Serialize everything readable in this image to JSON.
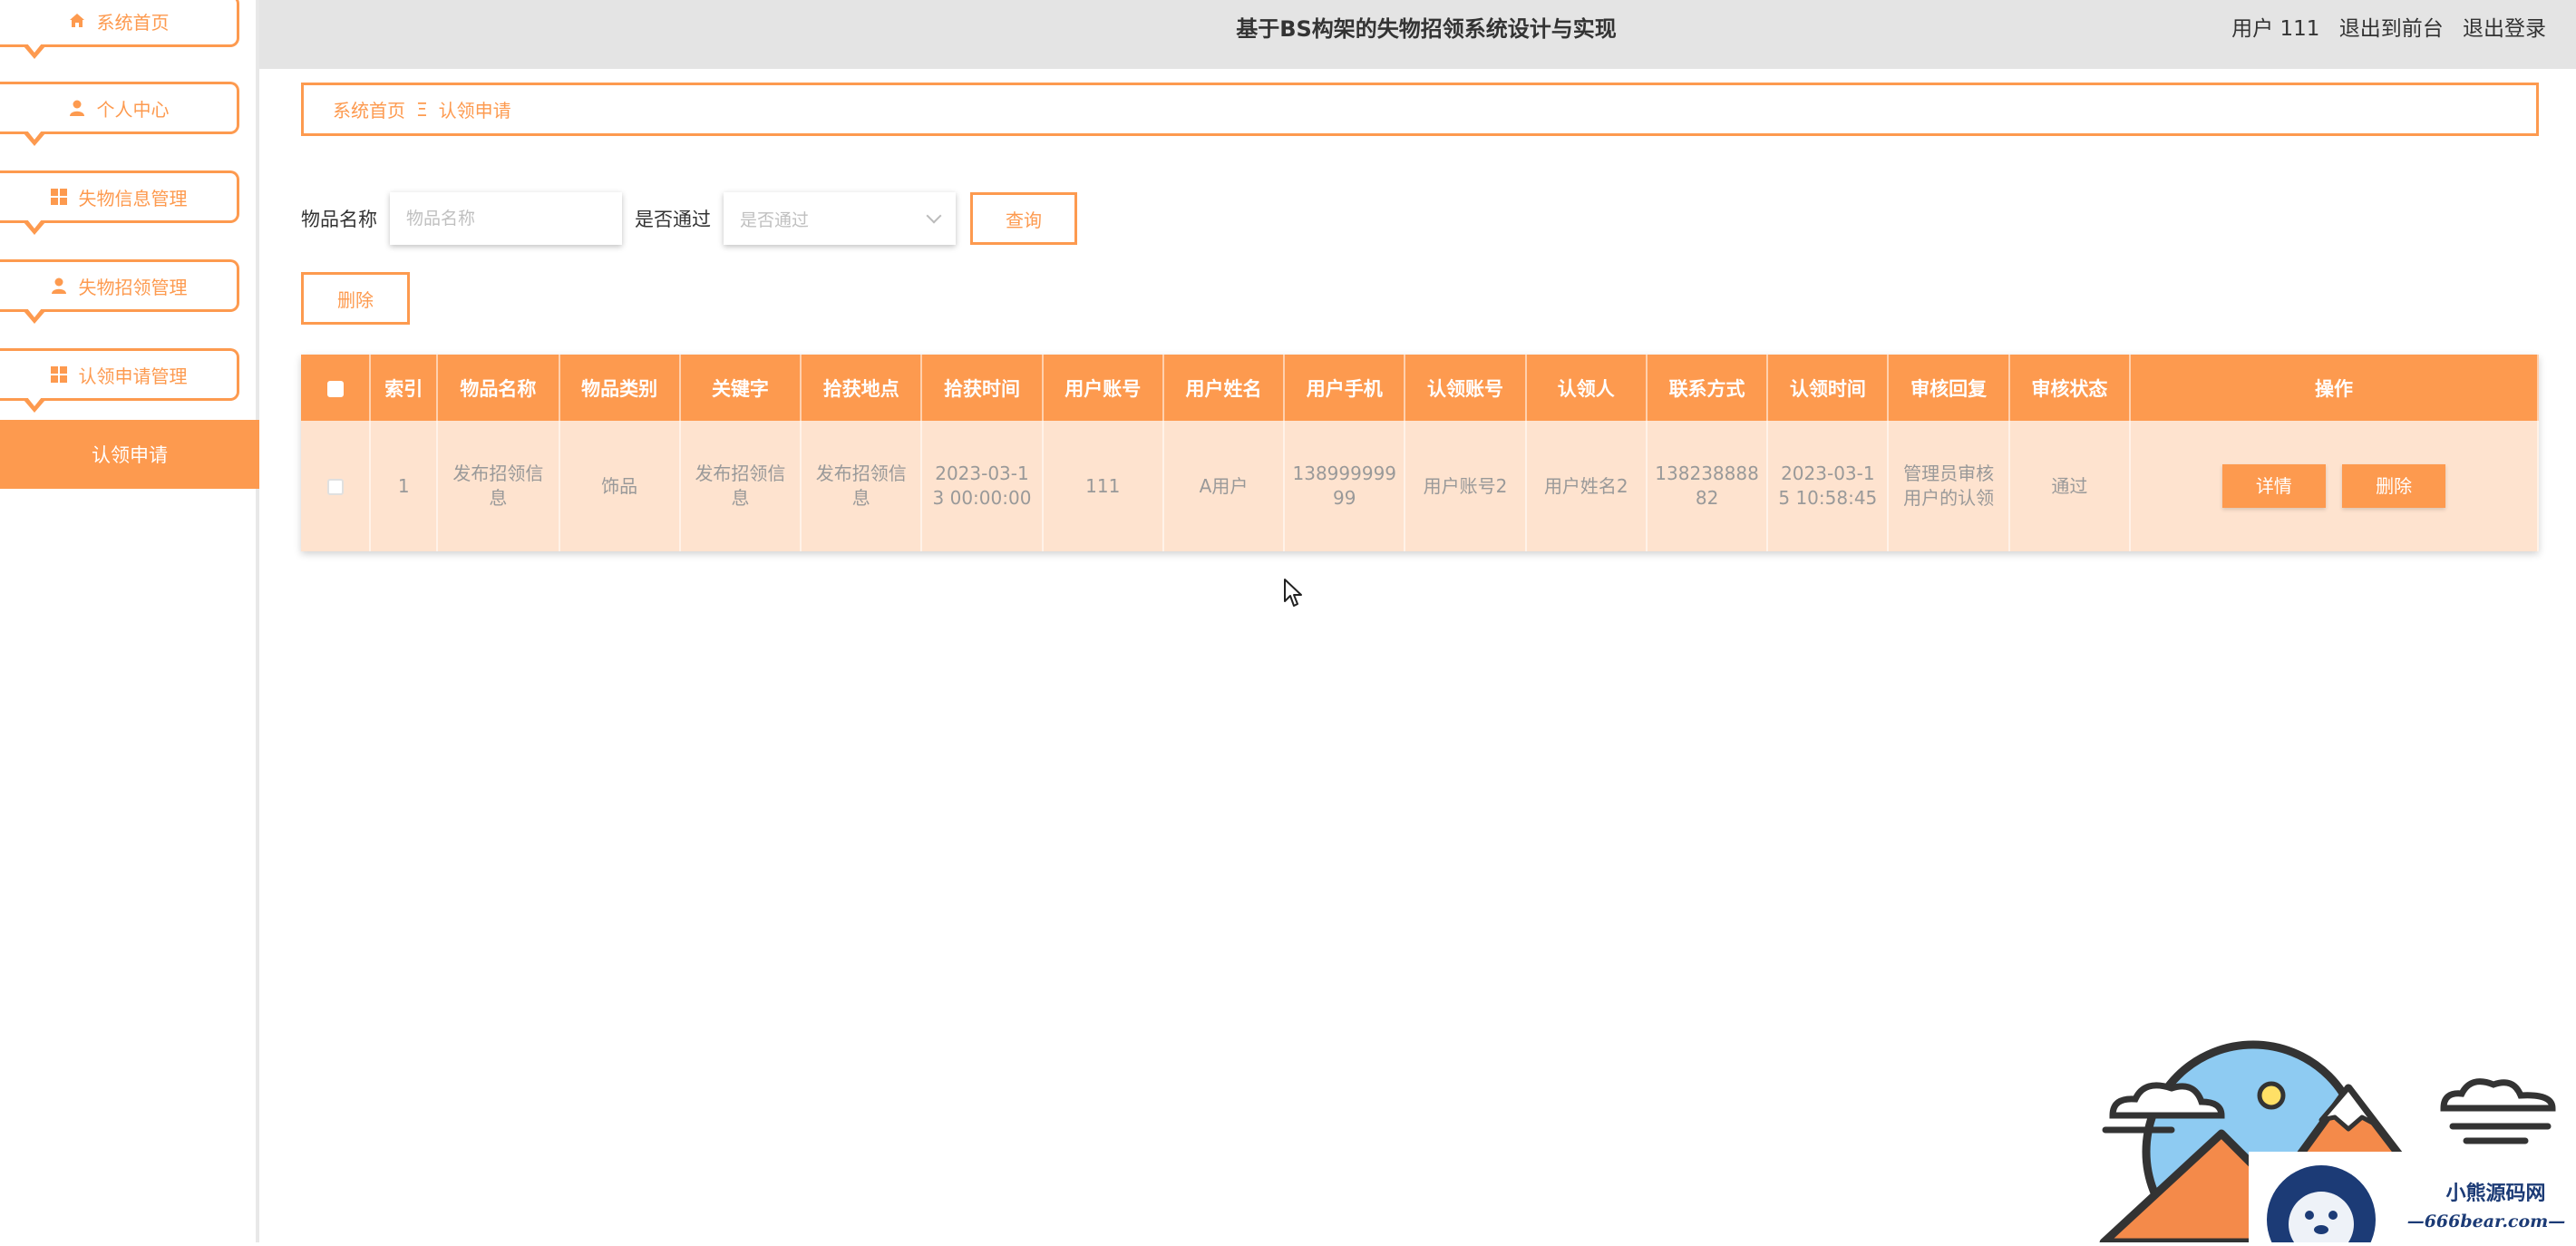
{
  "sidebar": {
    "items": [
      {
        "label": "系统首页",
        "icon": "home-icon"
      },
      {
        "label": "个人中心",
        "icon": "user-icon"
      },
      {
        "label": "失物信息管理",
        "icon": "grid-icon"
      },
      {
        "label": "失物招领管理",
        "icon": "user-icon"
      },
      {
        "label": "认领申请管理",
        "icon": "grid-icon"
      }
    ],
    "active_sub": "认领申请"
  },
  "header": {
    "title": "基于BS构架的失物招领系统设计与实现",
    "user": "用户 111",
    "to_front": "退出到前台",
    "logout": "退出登录"
  },
  "breadcrumb": {
    "home": "系统首页",
    "separator": "Ξ",
    "current": "认领申请"
  },
  "search": {
    "name_label": "物品名称",
    "name_placeholder": "物品名称",
    "pass_label": "是否通过",
    "pass_placeholder": "是否通过",
    "query_button": "查询"
  },
  "delete_button": "删除",
  "table": {
    "columns": [
      "索引",
      "物品名称",
      "物品类别",
      "关键字",
      "拾获地点",
      "拾获时间",
      "用户账号",
      "用户姓名",
      "用户手机",
      "认领账号",
      "认领人",
      "联系方式",
      "认领时间",
      "审核回复",
      "审核状态",
      "操作"
    ],
    "rows": [
      {
        "index": "1",
        "item_name": "发布招领信息",
        "category": "饰品",
        "keyword": "发布招领信息",
        "location": "发布招领信息",
        "found_time": "2023-03-13 00:00:00",
        "user_account": "111",
        "user_name": "A用户",
        "user_phone": "13899999999",
        "claim_account": "用户账号2",
        "claimer": "用户姓名2",
        "contact": "13823888882",
        "claim_time": "2023-03-15 10:58:45",
        "review_reply": "管理员审核用户的认领",
        "review_status": "通过",
        "detail_button": "详情",
        "delete_button": "删除"
      }
    ]
  },
  "watermark": {
    "line1": "小熊源码网",
    "line2": "—666bear.com—"
  },
  "colors": {
    "accent": "#fd9a4f",
    "row_bg": "#fee3cf",
    "topbar_bg": "#e4e4e4"
  }
}
